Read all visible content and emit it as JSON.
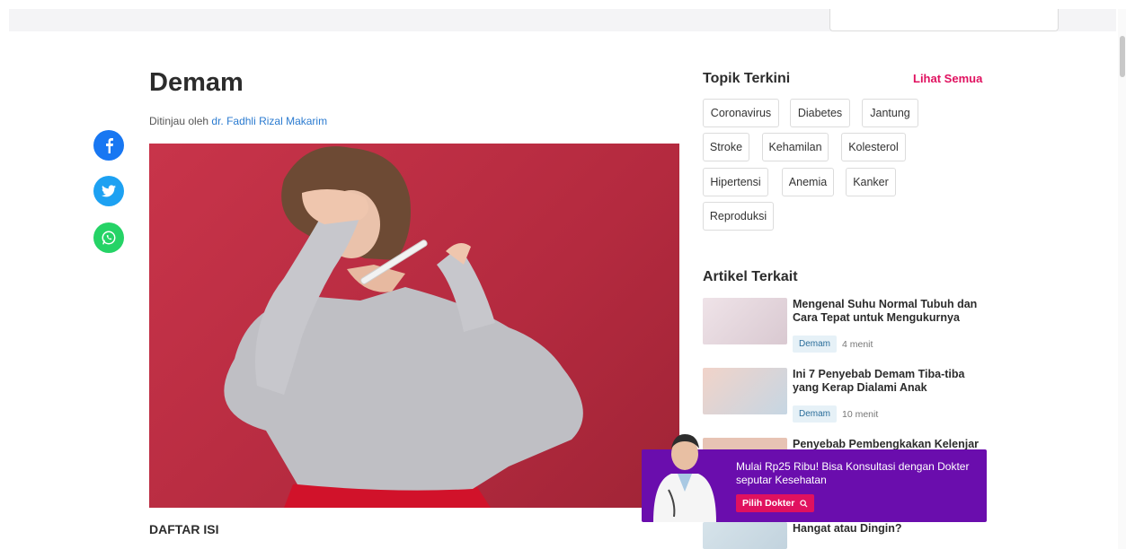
{
  "article": {
    "title": "Demam",
    "reviewed_prefix": "Ditinjau oleh",
    "reviewer": "dr. Fadhli Rizal Makarim",
    "toc_heading": "DAFTAR ISI"
  },
  "share": {
    "icons": [
      "facebook-icon",
      "twitter-icon",
      "whatsapp-icon"
    ]
  },
  "topics": {
    "heading": "Topik Terkini",
    "see_all": "Lihat Semua",
    "tags": [
      "Coronavirus",
      "Diabetes",
      "Jantung",
      "Stroke",
      "Kehamilan",
      "Kolesterol",
      "Hipertensi",
      "Anemia",
      "Kanker",
      "Reproduksi"
    ]
  },
  "related": {
    "heading": "Artikel Terkait",
    "items": [
      {
        "title": "Mengenal Suhu Normal Tubuh dan Cara Tepat untuk Mengukurnya",
        "tag": "Demam",
        "read_time": "4 menit"
      },
      {
        "title": "Ini 7 Penyebab Demam Tiba-tiba yang Kerap Dialami Anak",
        "tag": "Demam",
        "read_time": "10 menit"
      },
      {
        "title": "Penyebab Pembengkakan Kelenjar",
        "tag": "",
        "read_time": ""
      },
      {
        "title": "Hangat atau Dingin?",
        "tag": "",
        "read_time": ""
      }
    ]
  },
  "promo": {
    "text": "Mulai Rp25 Ribu! Bisa Konsultasi dengan Dokter seputar Kesehatan",
    "button": "Pilih Dokter"
  },
  "colors": {
    "accent": "#e0115f",
    "promo_bg": "#6a0dad",
    "link": "#2b7bd0"
  }
}
